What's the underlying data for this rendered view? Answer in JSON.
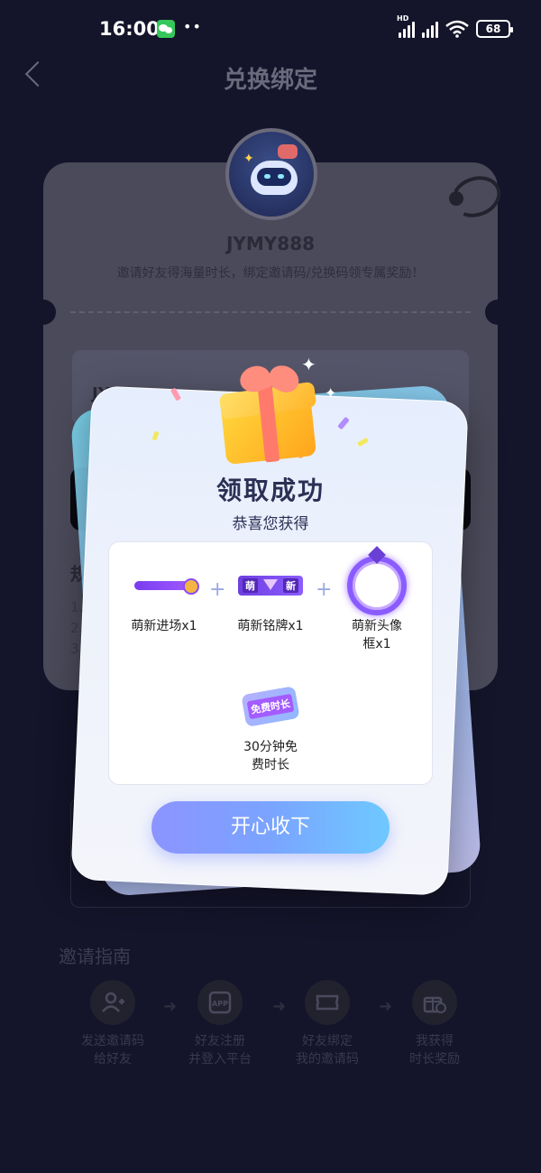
{
  "status_bar": {
    "time": "16:00",
    "dots": "••",
    "network": "HD",
    "battery": "68",
    "icons": [
      "wechat-icon",
      "signal-icon",
      "wifi-icon",
      "battery-icon"
    ]
  },
  "header": {
    "title": "兑换绑定",
    "back_icon": "chevron-left-icon"
  },
  "profile": {
    "username": "JYMY888",
    "description": "邀请好友得海量时长，绑定邀请码/兑换码领专属奖励！"
  },
  "background_form": {
    "input_partial": "JY",
    "rules_title": "规",
    "rule_lines": [
      "1、",
      "2、",
      "3、"
    ]
  },
  "invite_guide": {
    "title": "邀请指南",
    "steps": [
      {
        "label": "发送邀请码\n给好友",
        "icon": "add-user-icon"
      },
      {
        "label": "好友注册\n并登入平台",
        "icon": "app-icon"
      },
      {
        "label": "好友绑定\n我的邀请码",
        "icon": "ticket-icon"
      },
      {
        "label": "我获得\n时长奖励",
        "icon": "gift-clock-icon"
      }
    ]
  },
  "modal": {
    "title": "领取成功",
    "subtitle": "恭喜您获得",
    "rewards": [
      {
        "name": "萌新进场x1",
        "icon": "entry-effect-icon"
      },
      {
        "name": "萌新铭牌x1",
        "icon": "nameplate-icon",
        "badge_left": "萌",
        "badge_right": "新"
      },
      {
        "name": "萌新头像\n框x1",
        "icon": "avatar-frame-icon"
      },
      {
        "name": "30分钟免\n费时长",
        "icon": "free-time-ticket-icon",
        "ticket_text": "免费时长"
      }
    ],
    "plus": "+",
    "confirm_label": "开心收下"
  },
  "colors": {
    "background": "#14142a",
    "button_gradient_start": "#8c94ff",
    "button_gradient_end": "#6ec9ff",
    "title_text": "#2b3055"
  }
}
